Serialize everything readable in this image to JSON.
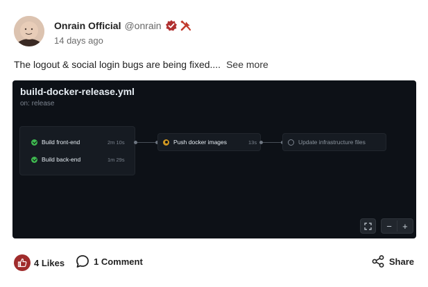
{
  "post": {
    "author": {
      "name": "Onrain Official",
      "handle": "@onrain",
      "badge_color": "#b03030"
    },
    "timestamp": "14 days ago",
    "text": "The logout & social login bugs are being fixed....",
    "see_more": "See more"
  },
  "workflow": {
    "title": "build-docker-release.yml",
    "trigger": "on: release",
    "jobs": [
      {
        "name": "Build front-end",
        "duration": "2m 10s",
        "status": "success"
      },
      {
        "name": "Build back-end",
        "duration": "1m 29s",
        "status": "success"
      },
      {
        "name": "Push docker images",
        "duration": "13s",
        "status": "running"
      },
      {
        "name": "Update infrastructure files",
        "duration": "",
        "status": "pending"
      }
    ],
    "controls": {
      "fullscreen": "fullscreen-icon",
      "zoom_out": "−",
      "zoom_in": "+"
    },
    "colors": {
      "background": "#0d1117",
      "success": "#3fb950",
      "running": "#d29922"
    }
  },
  "footer": {
    "likes": "4 Likes",
    "comments": "1 Comment",
    "share": "Share",
    "like_color": "#a02c2c"
  }
}
